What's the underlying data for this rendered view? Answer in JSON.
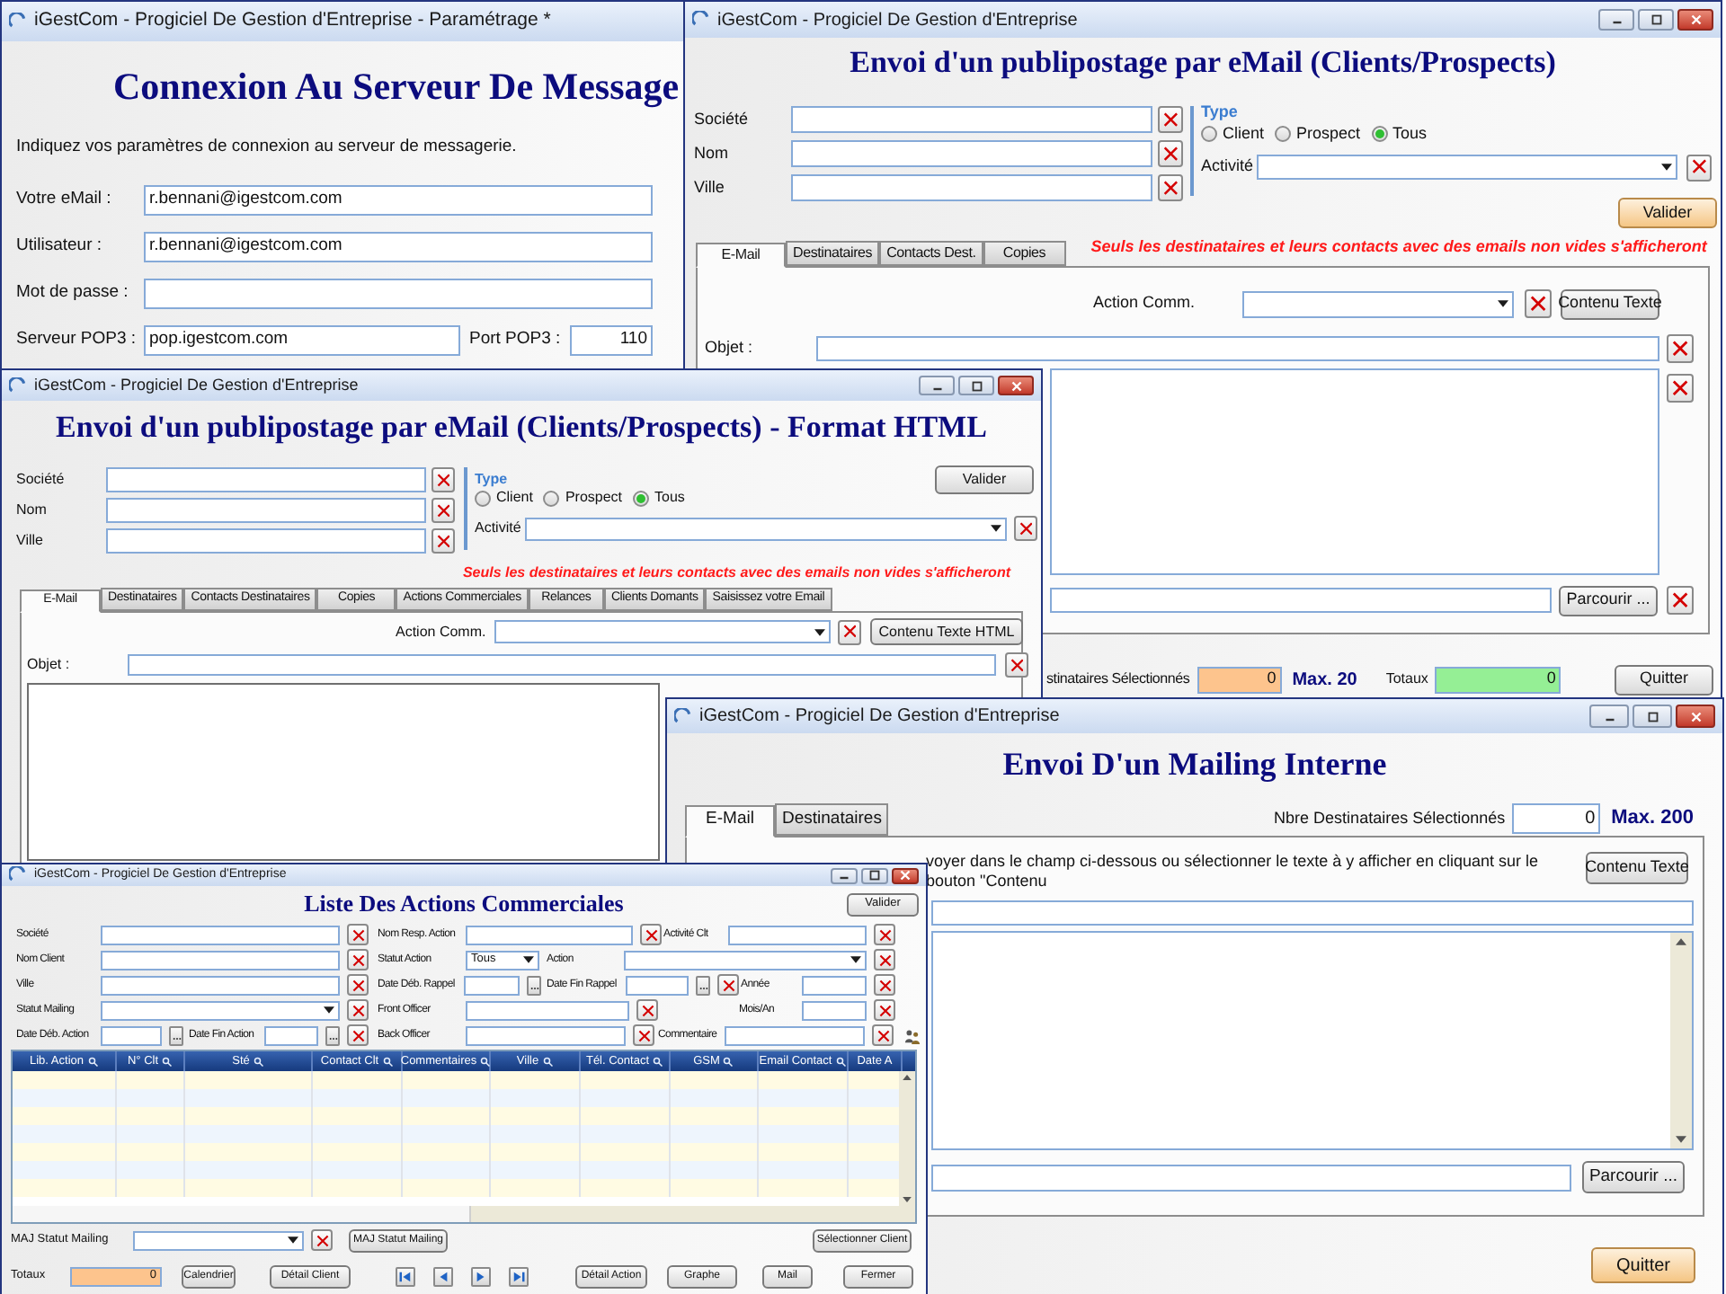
{
  "settings_window": {
    "title": "iGestCom - Progiciel De Gestion d'Entreprise - Paramétrage *",
    "heading": "Connexion Au Serveur De Message",
    "intro": "Indiquez vos paramètres de connexion au serveur de messagerie.",
    "fields": [
      {
        "label": "Votre eMail :",
        "value": "r.bennani@igestcom.com"
      },
      {
        "label": "Utilisateur :",
        "value": "r.bennani@igestcom.com"
      },
      {
        "label": "Mot de passe :"
      },
      {
        "label": "Serveur POP3 :",
        "value": "pop.igestcom.com",
        "port_label": "Port POP3 :",
        "port_value": "110"
      }
    ]
  },
  "mailing_window": {
    "title": "iGestCom - Progiciel De Gestion d'Entreprise",
    "heading": "Envoi d'un publipostage par eMail (Clients/Prospects)",
    "filters": [
      {
        "label": "Société"
      },
      {
        "label": "Nom"
      },
      {
        "label": "Ville"
      }
    ],
    "type_label": "Type",
    "type_options": [
      {
        "label": "Client",
        "selected": false
      },
      {
        "label": "Prospect",
        "selected": false
      },
      {
        "label": "Tous",
        "selected": true
      }
    ],
    "activity_label": "Activité",
    "validate_button": "Valider",
    "notice": "Seuls les destinataires et leurs contacts avec des emails non vides s'afficheront",
    "tabs": [
      {
        "label": "E-Mail",
        "selected": true
      },
      {
        "label": "Destinataires",
        "selected": false
      },
      {
        "label": "Contacts Dest.",
        "selected": false
      },
      {
        "label": "Copies",
        "selected": false
      }
    ],
    "action_label": "Action Comm.",
    "content_button": "Contenu Texte",
    "subject_label": "Objet :",
    "browse_button": "Parcourir ...",
    "selected_label": "stinataires Sélectionnés",
    "selected_count": "0",
    "max_label": "Max. 20",
    "totals_label": "Totaux",
    "totals_value": "0",
    "quit_button": "Quitter"
  },
  "html_mailing_window": {
    "title": "iGestCom - Progiciel De Gestion d'Entreprise",
    "heading": "Envoi d'un publipostage par eMail (Clients/Prospects) - Format HTML",
    "filters": [
      {
        "label": "Société"
      },
      {
        "label": "Nom"
      },
      {
        "label": "Ville"
      }
    ],
    "type_label": "Type",
    "type_options": [
      {
        "label": "Client",
        "selected": false
      },
      {
        "label": "Prospect",
        "selected": false
      },
      {
        "label": "Tous",
        "selected": true
      }
    ],
    "validate_button": "Valider",
    "activity_label": "Activité",
    "notice": "Seuls les destinataires et leurs contacts avec des emails non vides s'afficheront",
    "tabs": [
      {
        "label": "E-Mail",
        "selected": true
      },
      {
        "label": "Destinataires",
        "selected": false
      },
      {
        "label": "Contacts Destinataires",
        "selected": false
      },
      {
        "label": "Copies",
        "selected": false
      },
      {
        "label": "Actions Commerciales",
        "selected": false
      },
      {
        "label": "Relances",
        "selected": false
      },
      {
        "label": "Clients Domants",
        "selected": false
      },
      {
        "label": "Saisissez votre Email",
        "selected": false
      }
    ],
    "action_label": "Action Comm.",
    "content_button": "Contenu Texte HTML",
    "subject_label": "Objet :"
  },
  "internal_mailing_window": {
    "title": "iGestCom - Progiciel De Gestion d'Entreprise",
    "heading": "Envoi D'un Mailing Interne",
    "tabs": [
      {
        "label": "E-Mail",
        "selected": true
      },
      {
        "label": "Destinataires",
        "selected": false
      }
    ],
    "selected_label": "Nbre Destinataires Sélectionnés",
    "selected_count": "0",
    "max_label": "Max. 200",
    "instructions": "voyer dans le champ ci-dessous ou sélectionner le texte à y afficher en cliquant sur le bouton \"Contenu",
    "content_button": "Contenu Texte",
    "browse_button": "Parcourir ...",
    "quit_button": "Quitter"
  },
  "actions_list_window": {
    "title": "iGestCom - Progiciel De Gestion d'Entreprise",
    "heading": "Liste Des Actions Commerciales",
    "validate_button": "Valider",
    "filter_rows": [
      [
        {
          "label": "Société",
          "kind": "text"
        },
        {
          "label": "Nom Resp. Action",
          "kind": "text"
        },
        {
          "label": "Activité Clt",
          "kind": "text"
        }
      ],
      [
        {
          "label": "Nom Client",
          "kind": "text"
        },
        {
          "label": "Statut Action",
          "kind": "select",
          "value": "Tous"
        },
        {
          "label": "Action",
          "kind": "select"
        }
      ],
      [
        {
          "label": "Ville",
          "kind": "text"
        },
        {
          "label": "Date Déb. Rappel",
          "kind": "date"
        },
        {
          "label": "Date Fin Rappel",
          "kind": "date"
        },
        {
          "label": "Année",
          "kind": "text"
        }
      ],
      [
        {
          "label": "Statut Mailing",
          "kind": "select"
        },
        {
          "label": "Front Officer",
          "kind": "text"
        },
        {
          "label": "Mois/An",
          "kind": "text"
        }
      ],
      [
        {
          "label": "Date Déb. Action",
          "kind": "date"
        },
        {
          "label": "Date Fin Action",
          "kind": "date"
        },
        {
          "label": "Back Officer",
          "kind": "text"
        },
        {
          "label": "Commentaire",
          "kind": "text"
        }
      ]
    ],
    "columns": [
      "Lib. Action",
      "N° Clt",
      "Sté",
      "Contact Clt",
      "Commentaires",
      "Ville",
      "Tél. Contact",
      "GSM",
      "Email Contact",
      "Date A"
    ],
    "mailing_status_label": "MAJ Statut Mailing",
    "mailing_update_button": "MAJ Statut Mailing",
    "select_client_button": "Sélectionner Client",
    "totals_label": "Totaux",
    "totals_value": "0",
    "left_buttons": [
      "Calendrier",
      "Détail Client"
    ],
    "right_buttons": [
      "Détail Action",
      "Graphe",
      "Mail",
      "Fermer"
    ]
  }
}
